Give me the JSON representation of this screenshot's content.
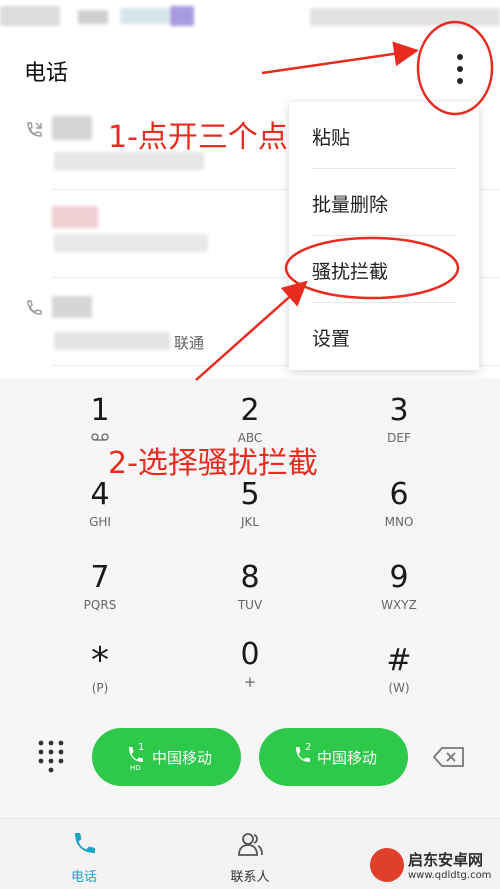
{
  "header": {
    "title": "电话"
  },
  "recents": [
    {
      "carrier": ""
    },
    {
      "carrier": ""
    },
    {
      "carrier": "联通"
    }
  ],
  "menu": {
    "items": [
      {
        "label": "粘贴"
      },
      {
        "label": "批量删除"
      },
      {
        "label": "骚扰拦截"
      },
      {
        "label": "设置"
      }
    ]
  },
  "keypad": {
    "keys": [
      {
        "digit": "1",
        "letters": ""
      },
      {
        "digit": "2",
        "letters": "ABC"
      },
      {
        "digit": "3",
        "letters": "DEF"
      },
      {
        "digit": "4",
        "letters": "GHI"
      },
      {
        "digit": "5",
        "letters": "JKL"
      },
      {
        "digit": "6",
        "letters": "MNO"
      },
      {
        "digit": "7",
        "letters": "PQRS"
      },
      {
        "digit": "8",
        "letters": "TUV"
      },
      {
        "digit": "9",
        "letters": "WXYZ"
      },
      {
        "digit": "*",
        "letters": "(P)"
      },
      {
        "digit": "0",
        "letters": "+"
      },
      {
        "digit": "#",
        "letters": "(W)"
      }
    ]
  },
  "call_buttons": [
    {
      "label": "中国移动",
      "sim": "1",
      "badge": "HD"
    },
    {
      "label": "中国移动",
      "sim": "2"
    }
  ],
  "bottom_nav": {
    "items": [
      {
        "label": "电话"
      },
      {
        "label": "联系人"
      }
    ]
  },
  "annotations": {
    "step1": "1-点开三个点",
    "step2": "2-选择骚扰拦截"
  },
  "watermark": {
    "name": "启东安卓网",
    "url": "www.qdldtg.com"
  },
  "colors": {
    "accent_green": "#2ec84a",
    "annotation_red": "#e82a1f",
    "nav_active": "#1aa3c8"
  },
  "icons": {
    "more": "more-vertical-icon",
    "dialpad": "dialpad-grid-icon",
    "backspace": "backspace-icon",
    "phone": "phone-icon",
    "contacts": "contacts-icon"
  }
}
